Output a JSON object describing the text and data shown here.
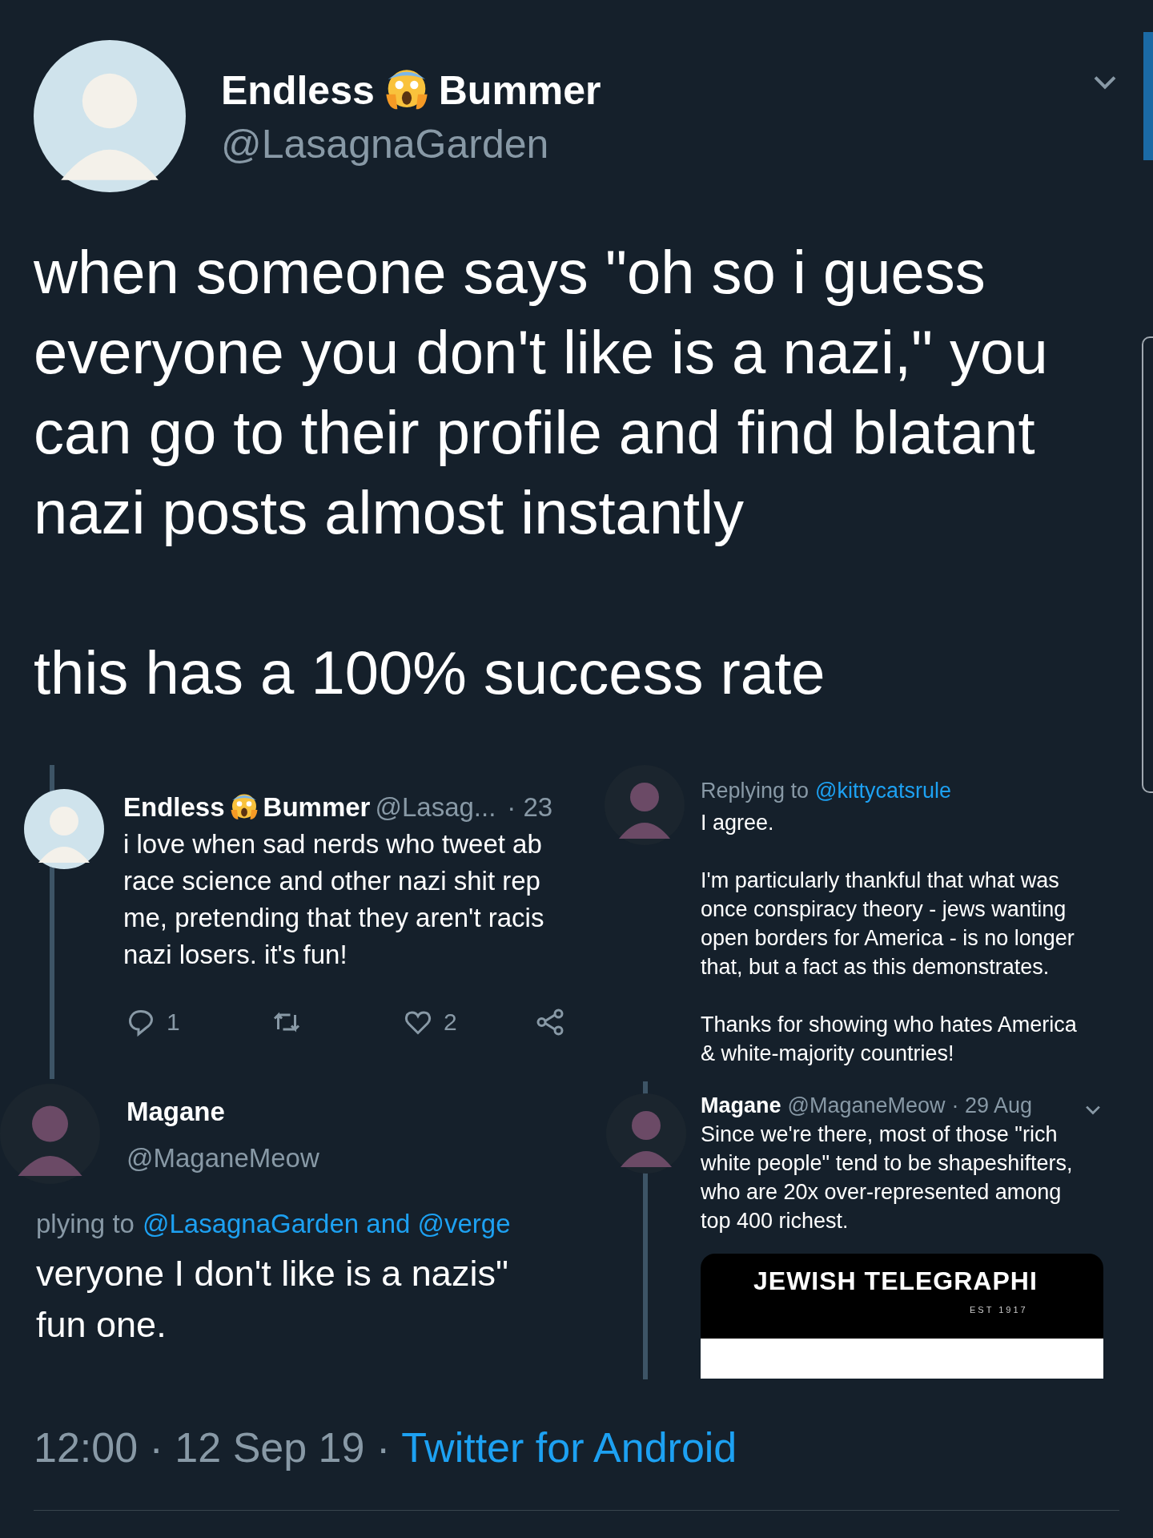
{
  "author": {
    "name_start": "Endless",
    "name_end": "Bummer",
    "handle": "@LasagnaGarden"
  },
  "text_lines": [
    "when someone says \"oh so i guess",
    "everyone you don't like is a nazi,\" you",
    "can go to their profile and find blatant",
    "nazi posts almost instantly"
  ],
  "text_last": "this has a 100% success rate",
  "collage": {
    "top_left": {
      "name_start": "Endless",
      "name_end": "Bummer",
      "handle": "@Lasag...",
      "time": "· 23",
      "lines": [
        "i love when sad nerds who tweet ab",
        "race science and other nazi shit rep",
        "me, pretending that they aren't racis",
        "nazi losers. it's fun!"
      ],
      "replies": "1",
      "likes": "2"
    },
    "top_right": {
      "replying_label": "Replying to",
      "replying_to": "@kittycatsrule",
      "paragraphs": [
        [
          "I agree."
        ],
        [
          "I'm particularly thankful that what was",
          "once conspiracy theory - jews wanting",
          "open borders for America - is no longer",
          "that, but a fact as this demonstrates."
        ],
        [
          "Thanks for showing who hates America",
          "& white-majority countries!"
        ]
      ]
    },
    "bottom_left": {
      "name": "Magane",
      "handle": "@MaganeMeow",
      "replying_label": "plying to",
      "replying_to": "@LasagnaGarden and @verge",
      "lines": [
        "veryone I don't like is a nazis\"",
        "fun one."
      ]
    },
    "bottom_right": {
      "name": "Magane",
      "handle": "@MaganeMeow",
      "time": "· 29 Aug",
      "lines": [
        "Since we're there, most of those \"rich",
        "white people\" tend to be shapeshifters,",
        "who are 20x over-represented among",
        "top 400 richest."
      ],
      "card": {
        "title": "JEWISH TELEGRAPHI",
        "subtitle": "EST 1917"
      }
    }
  },
  "footer": {
    "time": "12:00 · 12 Sep 19 ·",
    "source": "Twitter for Android"
  }
}
